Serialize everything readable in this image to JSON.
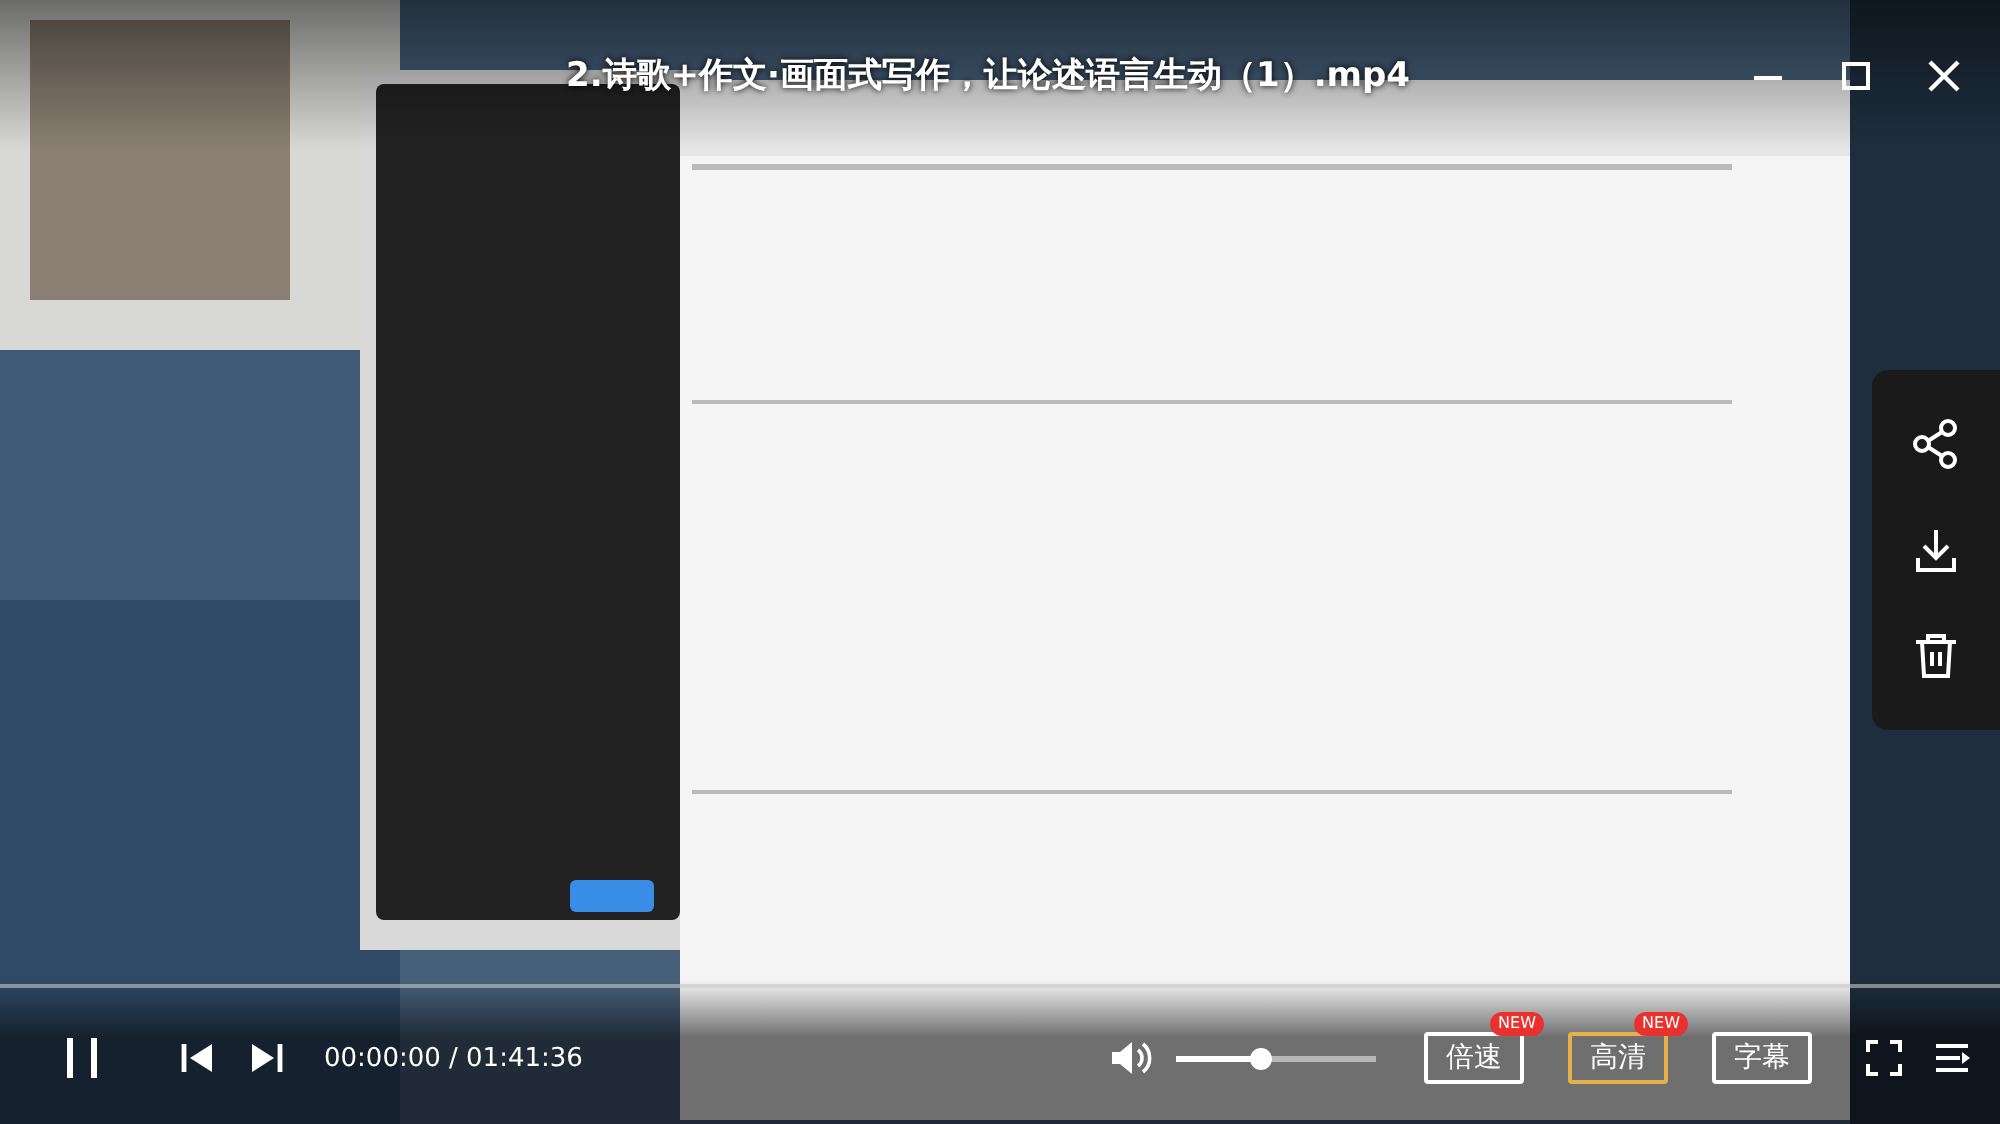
{
  "window": {
    "title": "2.诗歌+作文·画面式写作，让论述语言生动（1）.mp4"
  },
  "player": {
    "progress": {
      "level": 0.0
    },
    "playing": true,
    "time": "00:00:00 / 01:41:36",
    "volume": {
      "level": 0.42
    },
    "options": [
      {
        "label": "倍速",
        "badge": "NEW",
        "selected": false
      },
      {
        "label": "高清",
        "badge": "NEW",
        "selected": true
      },
      {
        "label": "字幕",
        "selected": false
      }
    ]
  }
}
